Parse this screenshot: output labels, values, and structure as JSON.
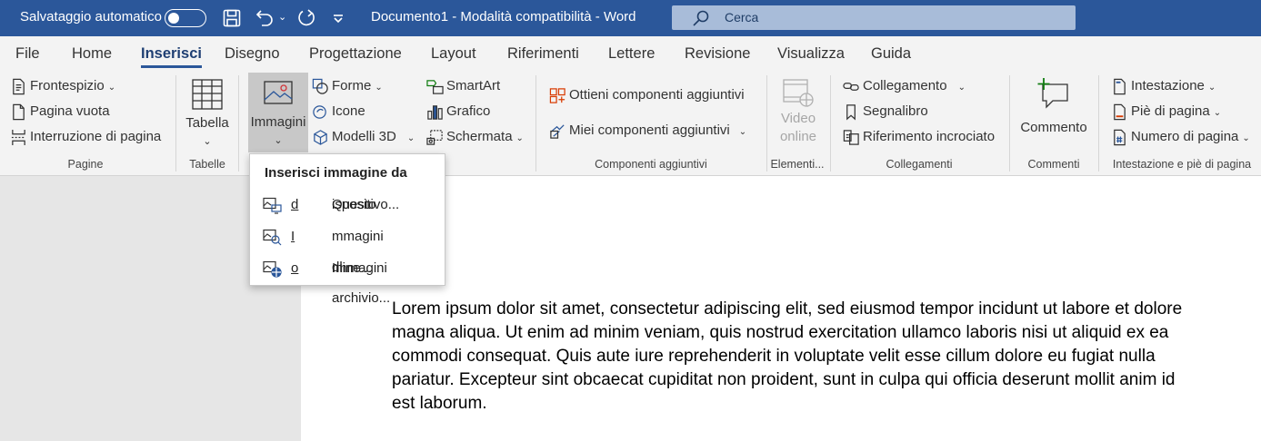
{
  "titlebar": {
    "autosave_label": "Salvataggio automatico",
    "document_title": "Documento1  -  Modalità compatibilità  -  Word",
    "search_placeholder": "Cerca",
    "colors": {
      "bar": "#2b579a",
      "search": "#a8bcd9"
    },
    "icons": [
      "save-icon",
      "undo-icon",
      "redo-icon",
      "customize-icon",
      "search-icon"
    ]
  },
  "menu": {
    "tabs": [
      "File",
      "Home",
      "Inserisci",
      "Disegno",
      "Progettazione",
      "Layout",
      "Riferimenti",
      "Lettere",
      "Revisione",
      "Visualizza",
      "Guida"
    ],
    "active": "Inserisci"
  },
  "ribbon": {
    "pagine": {
      "label": "Pagine",
      "items": [
        "Frontespizio",
        "Pagina vuota",
        "Interruzione di pagina"
      ]
    },
    "tabelle": {
      "label": "Tabelle",
      "button": "Tabella"
    },
    "illustrazioni": {
      "immagini": "Immagini",
      "forme": "Forme",
      "icone": "Icone",
      "modelli3d": "Modelli 3D",
      "smartart": "SmartArt",
      "grafico": "Grafico",
      "schermata": "Schermata"
    },
    "componenti": {
      "label": "Componenti aggiuntivi",
      "ottieni": "Ottieni componenti aggiuntivi",
      "miei": "Miei componenti aggiuntivi"
    },
    "elementi": {
      "label": "Elementi...",
      "video_line1": "Video",
      "video_line2": "online"
    },
    "collegamenti": {
      "label": "Collegamenti",
      "items": [
        "Collegamento",
        "Segnalibro",
        "Riferimento incrociato"
      ]
    },
    "commenti": {
      "label": "Commenti",
      "button": "Commento"
    },
    "intestazione": {
      "label": "Intestazione e piè di pagina",
      "items": [
        "Intestazione",
        "Piè di pagina",
        "Numero di pagina"
      ]
    }
  },
  "dropdown": {
    "header": "Inserisci immagine da",
    "items": [
      {
        "before": "Questo ",
        "underline": "d",
        "after": "ispositivo..."
      },
      {
        "before": "",
        "underline": "I",
        "after": "mmagini di archivio..."
      },
      {
        "before": "Immagini ",
        "underline": "o",
        "after": "nline..."
      }
    ]
  },
  "document": {
    "body": "Lorem ipsum dolor sit amet, consectetur adipiscing elit, sed eiusmod tempor incidunt ut labore et dolore magna aliqua. Ut enim ad minim veniam, quis nostrud exercitation ullamco laboris nisi ut aliquid ex ea commodi consequat. Quis aute iure reprehenderit in voluptate velit esse cillum dolore eu fugiat nulla pariatur. Excepteur sint obcaecat cupiditat non proident, sunt in culpa qui officia deserunt mollit anim id est laborum."
  }
}
